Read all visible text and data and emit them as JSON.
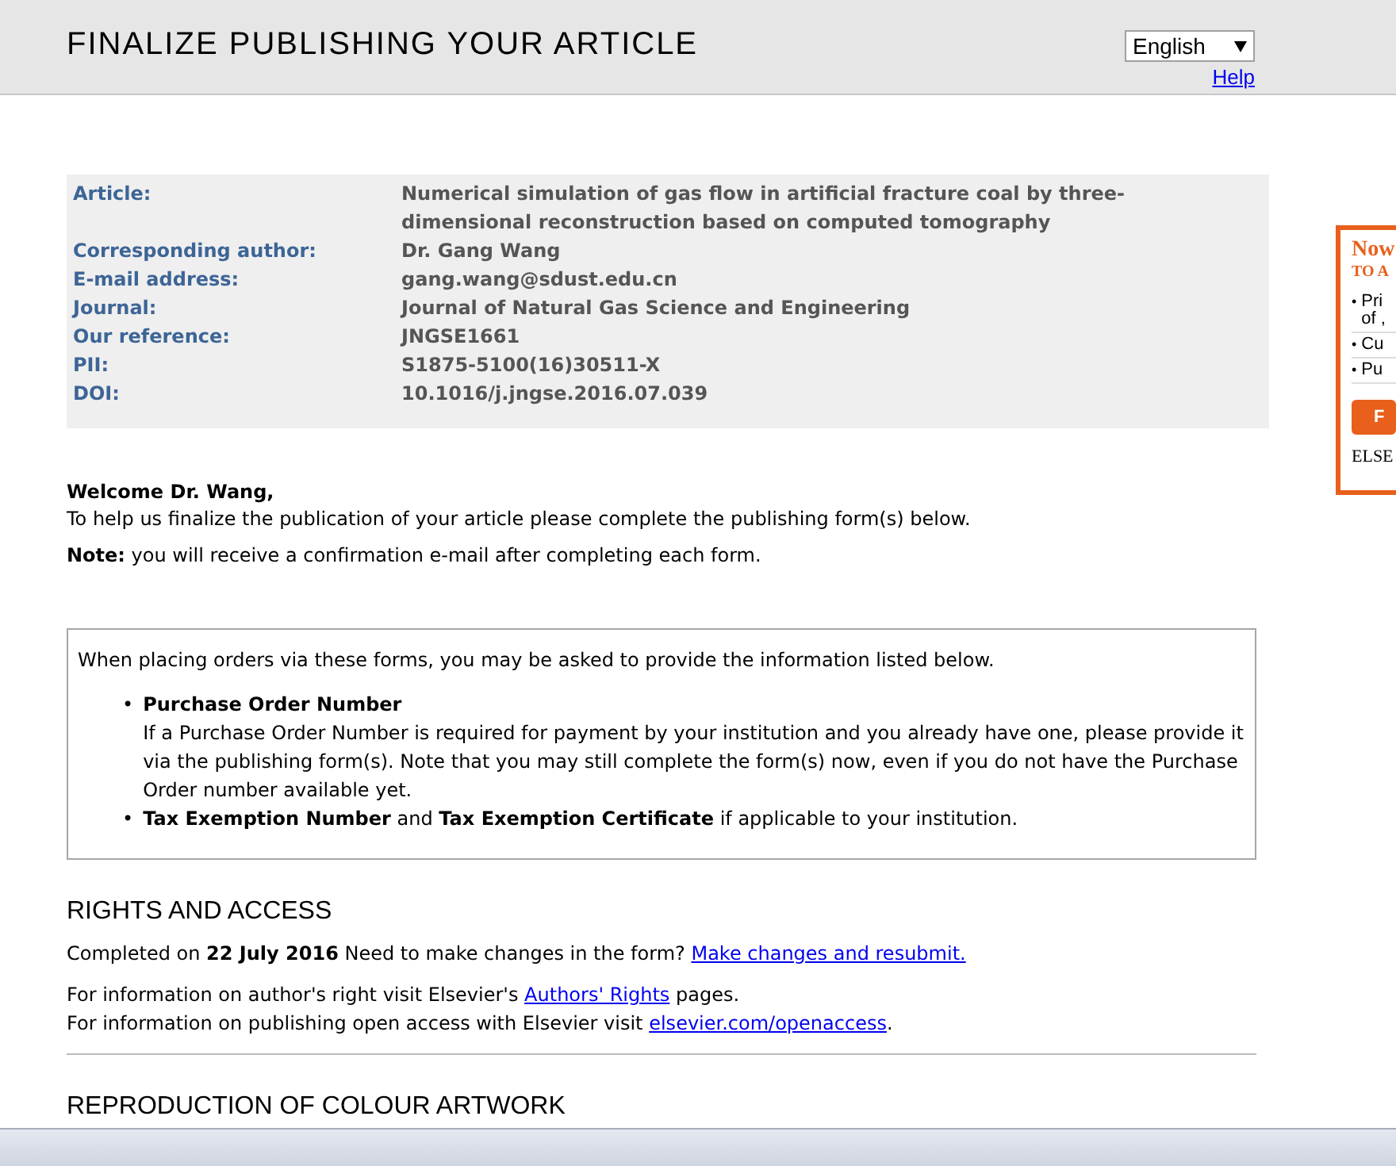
{
  "header": {
    "title": "FINALIZE PUBLISHING YOUR ARTICLE",
    "language": "English",
    "help_link": "Help"
  },
  "article_info": [
    {
      "label": "Article:",
      "value": "Numerical simulation of gas flow in artificial fracture coal by three-dimensional reconstruction based on computed tomography"
    },
    {
      "label": "Corresponding author:",
      "value": "Dr. Gang Wang"
    },
    {
      "label": "E-mail address:",
      "value": "gang.wang@sdust.edu.cn"
    },
    {
      "label": "Journal:",
      "value": "Journal of Natural Gas Science and Engineering"
    },
    {
      "label": "Our reference:",
      "value": "JNGSE1661"
    },
    {
      "label": "PII:",
      "value": "S1875-5100(16)30511-X"
    },
    {
      "label": "DOI:",
      "value": "10.1016/j.jngse.2016.07.039"
    }
  ],
  "welcome": {
    "greeting": "Welcome Dr. Wang,",
    "intro": "To help us finalize the publication of your article please complete the publishing form(s) below.",
    "note": "**Note:** you will receive a confirmation e-mail after completing each form."
  },
  "info_box": {
    "intro": "When placing orders via these forms, you may be asked to provide the information listed below.",
    "items": [
      {
        "marker": "•",
        "title": "Purchase Order Number",
        "text": "If a Purchase Order Number is required for payment by your institution and you already have one, please provide it via the publishing form(s). Note that you may still complete the form(s) now, even if you do not have the Purchase Order number available yet."
      },
      {
        "marker": "•",
        "text": "**Tax Exemption Number** and **Tax Exemption Certificate** if applicable to your institution."
      }
    ]
  },
  "rights": {
    "heading": "RIGHTS AND ACCESS",
    "status": "Completed on **22 July 2016** Need to make changes in the form?",
    "status_link": "Make changes and resubmit.",
    "lines": [
      {
        "before": "For information on author's right visit Elsevier's",
        "link": "Authors' Rights",
        "after": "pages."
      },
      {
        "before": "For information on publishing open access with Elsevier visit",
        "link": "elsevier.com/openaccess",
        "after": "."
      }
    ]
  },
  "next_heading": "REPRODUCTION OF COLOUR ARTWORK",
  "ad": {
    "headline": "Now",
    "subhead": "TO A",
    "bullets": [
      {
        "marker": "•",
        "lines": [
          "Pri",
          "of ,"
        ]
      },
      {
        "marker": "•",
        "lines": [
          "Cu"
        ]
      },
      {
        "marker": "•",
        "lines": [
          "Pu"
        ]
      }
    ],
    "button": "F",
    "logo": "ELSE"
  }
}
